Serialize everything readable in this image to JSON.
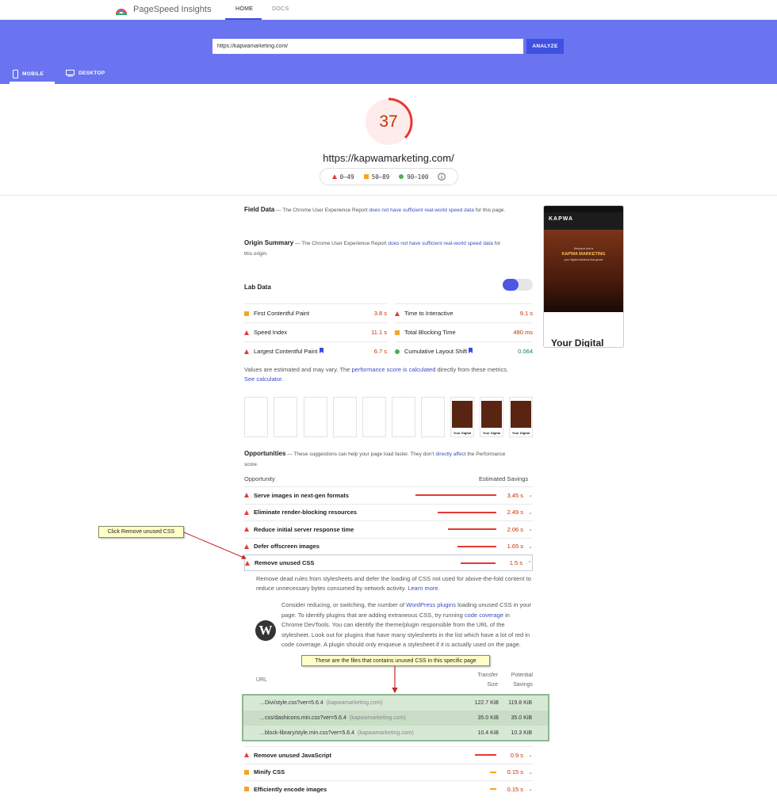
{
  "topbar": {
    "brand": "PageSpeed Insights",
    "tabs": [
      "HOME",
      "DOCS"
    ]
  },
  "hero": {
    "url_value": "https://kapwamarketing.com/",
    "analyze_label": "ANALYZE",
    "devices": [
      "MOBILE",
      "DESKTOP"
    ]
  },
  "score": {
    "value": "37",
    "fraction": 0.37,
    "url": "https://kapwamarketing.com/",
    "legend": [
      "0–49",
      "50–89",
      "90–100"
    ]
  },
  "field": {
    "title": "Field Data",
    "desc_pre": " — The Chrome User Experience Report ",
    "desc_link": "does not have sufficient real-world speed data",
    "desc_post": " for this page."
  },
  "origin": {
    "title": "Origin Summary",
    "desc_pre": " — The Chrome User Experience Report ",
    "desc_link": "does not have sufficient real-world speed data",
    "desc_post": " for this origin."
  },
  "lab": {
    "title": "Lab Data",
    "metrics": [
      {
        "label": "First Contentful Paint",
        "value": "3.8 s"
      },
      {
        "label": "Time to Interactive",
        "value": "9.1 s"
      },
      {
        "label": "Speed Index",
        "value": "11.1 s"
      },
      {
        "label": "Total Blocking Time",
        "value": "490 ms"
      },
      {
        "label": "Largest Contentful Paint",
        "value": "6.7 s"
      },
      {
        "label": "Cumulative Layout Shift",
        "value": "0.064"
      }
    ],
    "note_pre": "Values are estimated and may vary. The ",
    "note_link1": "performance score is calculated",
    "note_mid": " directly from these metrics. ",
    "note_link2": "See calculator."
  },
  "filmstrip": {
    "caption": "Your Digital"
  },
  "preview": {
    "logo": "KAPWA",
    "welcome": "Welcome this is",
    "headline": "KAPWA MARKETING",
    "tagline": "your digital solutions that grows",
    "heading": "Your Digital"
  },
  "opportunities": {
    "title": "Opportunities",
    "desc_pre": " — These suggestions can help your page load faster. They don't ",
    "desc_link": "directly affect",
    "desc_post": " the Performance score.",
    "col_left": "Opportunity",
    "col_right": "Estimated Savings",
    "items": [
      {
        "label": "Serve images in next-gen formats",
        "value": "3.45 s",
        "savings": 3.45
      },
      {
        "label": "Eliminate render-blocking resources",
        "value": "2.49 s",
        "savings": 2.49
      },
      {
        "label": "Reduce initial server response time",
        "value": "2.06 s",
        "savings": 2.06
      },
      {
        "label": "Defer offscreen images",
        "value": "1.65 s",
        "savings": 1.65
      },
      {
        "label": "Remove unused CSS",
        "value": "1.5 s",
        "savings": 1.5
      }
    ],
    "more": [
      {
        "label": "Remove unused JavaScript",
        "value": "0.9 s",
        "savings": 0.9
      },
      {
        "label": "Minify CSS",
        "value": "0.15 s",
        "savings": 0.15
      },
      {
        "label": "Efficiently encode images",
        "value": "0.15 s",
        "savings": 0.15
      }
    ]
  },
  "detail": {
    "desc": "Remove dead rules from stylesheets and defer the loading of CSS not used for above-the-fold content to reduce unnecessary bytes consumed by network activity. ",
    "learn_more": "Learn more.",
    "wp_pre": "Consider reducing, or switching, the number of ",
    "wp_link1": "WordPress plugins",
    "wp_mid1": " loading unused CSS in your page. To identify plugins that are adding extraneous CSS, try running ",
    "wp_link2": "code coverage",
    "wp_post": " in Chrome DevTools. You can identify the theme/plugin responsible from the URL of the stylesheet. Look out for plugins that have many stylesheets in the list which have a lot of red in code coverage. A plugin should only enqueue a stylesheet if it is actually used on the page.",
    "col_url": "URL",
    "col_transfer": "Transfer Size",
    "col_savings": "Potential Savings",
    "rows": [
      {
        "url": "…Divi/style.css?ver=5.6.4",
        "domain": "(kapwamarketing.com)",
        "transfer": "122.7 KiB",
        "savings": "119.8 KiB"
      },
      {
        "url": "…css/dashicons.min.css?ver=5.6.4",
        "domain": "(kapwamarketing.com)",
        "transfer": "35.0 KiB",
        "savings": "35.0 KiB"
      },
      {
        "url": "…block-library/style.min.css?ver=5.6.4",
        "domain": "(kapwamarketing.com)",
        "transfer": "10.4 KiB",
        "savings": "10.3 KiB"
      }
    ]
  },
  "callouts": {
    "click": "Click Remove unused CSS",
    "files": "These are the files that contains unused CSS in this specific page"
  },
  "colors": {
    "hero": "#6a74f0",
    "poor": "#e53935",
    "average": "#f4a524",
    "good": "#4caf50"
  }
}
